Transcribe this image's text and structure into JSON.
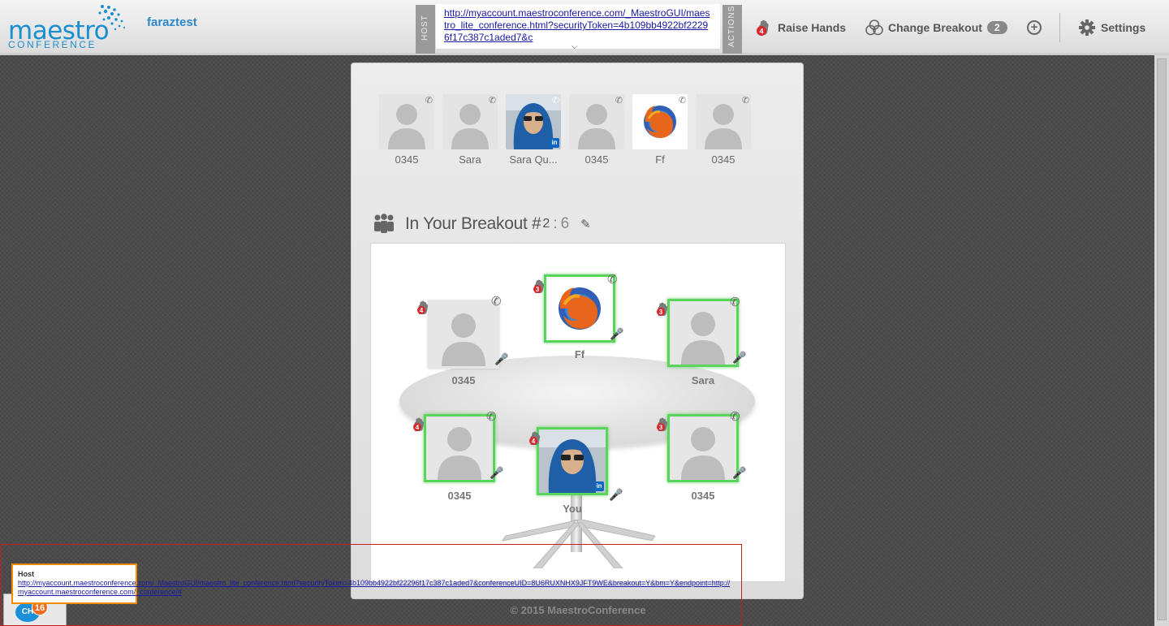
{
  "brand": {
    "logo_main": "maestro",
    "logo_sub": "CONFERENCE"
  },
  "header": {
    "username": "faraztest",
    "host_tab": "HOST",
    "actions_tab": "ACTIONS",
    "url": "http://myaccount.maestroconference.com/_MaestroGUI/maestro_lite_conference.html?securityToken=4b109bb4922bf22296f17c387c1aded7&c",
    "raise_hands": {
      "label": "Raise Hands",
      "count": "4"
    },
    "change_breakout": {
      "label": "Change Breakout",
      "count": "2"
    },
    "settings": "Settings"
  },
  "strip": [
    {
      "name": "0345",
      "type": "default"
    },
    {
      "name": "Sara",
      "type": "default"
    },
    {
      "name": "Sara Qu...",
      "type": "photo",
      "linkedin": "in"
    },
    {
      "name": "0345",
      "type": "default"
    },
    {
      "name": "Ff",
      "type": "firefox"
    },
    {
      "name": "0345",
      "type": "default"
    }
  ],
  "breakout": {
    "title": "In Your Breakout #",
    "number": "2",
    "separator": ":",
    "count": "6"
  },
  "seats": {
    "top_left": {
      "name": "0345",
      "hands": "4"
    },
    "top": {
      "name": "Ff",
      "hands": "3"
    },
    "top_right": {
      "name": "Sara",
      "hands": "3"
    },
    "bottom_left": {
      "name": "0345",
      "hands": "4"
    },
    "bottom": {
      "name": "You",
      "hands": "4",
      "linkedin": "in"
    },
    "bottom_right": {
      "name": "0345",
      "hands": "3"
    }
  },
  "footer": {
    "copyright": "© 2015 MaestroConference"
  },
  "host_popup": {
    "title": "Host",
    "link": "http://myaccount.maestroconference.com/_MaestroGUI/maestro_lite_conference.html?securityToken=4b109bb4922bf22296f17c387c1aded7&conferenceUID=8U6RUXNHX9JFT9WE&breakout=Y&bm=Y&endpoint=http://myaccount.maestroconference.com/_conference/#"
  },
  "chat": {
    "label": "CH",
    "count": "16"
  },
  "colors": {
    "accent": "#1a8fd0",
    "highlight_green": "#5ad45a",
    "badge_red": "#d8262a",
    "chat_orange": "#f06a1e"
  }
}
